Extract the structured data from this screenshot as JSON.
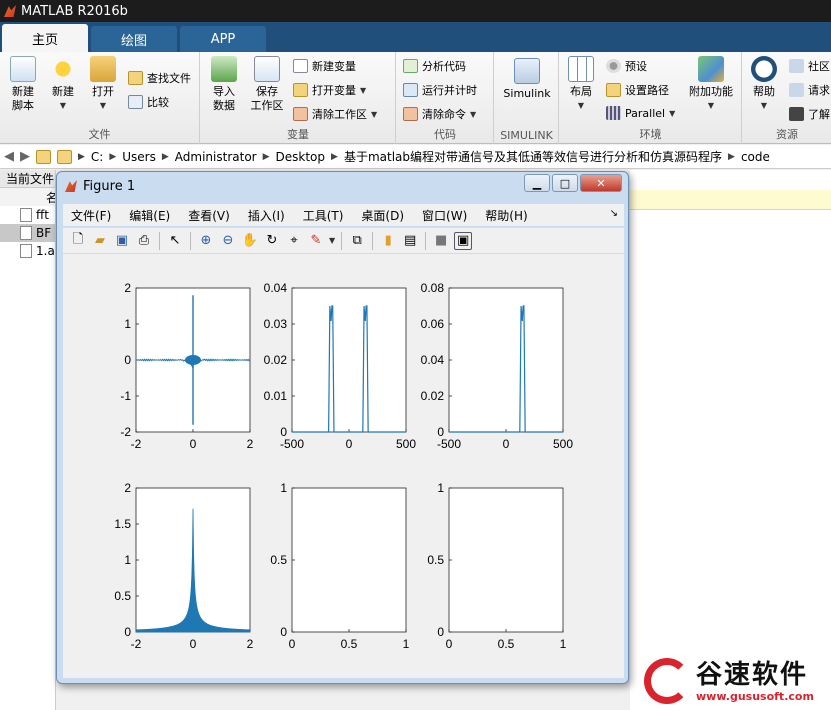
{
  "app": {
    "title": "MATLAB R2016b",
    "accent": "#1f4f7a"
  },
  "tabs": [
    {
      "label": "主页",
      "active": true
    },
    {
      "label": "绘图",
      "active": false
    },
    {
      "label": "APP",
      "active": false
    }
  ],
  "ribbon": {
    "file": {
      "label": "文件",
      "new_script": "新建\n脚本",
      "new": "新建",
      "open": "打开",
      "find_files": "查找文件",
      "compare": "比较"
    },
    "variable": {
      "label": "变量",
      "import": "导入\n数据",
      "save_ws": "保存\n工作区",
      "new_var": "新建变量",
      "open_var": "打开变量",
      "clear_ws": "清除工作区"
    },
    "code": {
      "label": "代码",
      "analyze": "分析代码",
      "run_time": "运行并计时",
      "clear_cmd": "清除命令"
    },
    "simulink": {
      "label": "SIMULINK",
      "button": "Simulink"
    },
    "env": {
      "label": "环境",
      "layout": "布局",
      "prefs": "预设",
      "set_path": "设置路径",
      "parallel": "Parallel",
      "addons": "附加功能"
    },
    "resources": {
      "label": "资源",
      "help": "帮助",
      "community": "社区",
      "request": "请求",
      "learn": "了解"
    }
  },
  "address": {
    "crumbs": [
      "C:",
      "Users",
      "Administrator",
      "Desktop",
      "基于matlab编程对带通信号及其低通等效信号进行分析和仿真源码程序",
      "code"
    ]
  },
  "left_panel": {
    "header": "当前文件",
    "col": "名",
    "files": [
      {
        "name": "fft",
        "selected": false
      },
      {
        "name": "BF",
        "selected": true
      },
      {
        "name": "1.a",
        "selected": false
      }
    ]
  },
  "figure": {
    "title": "Figure 1",
    "menus": [
      "文件(F)",
      "编辑(E)",
      "查看(V)",
      "插入(I)",
      "工具(T)",
      "桌面(D)",
      "窗口(W)",
      "帮助(H)"
    ]
  },
  "chart_data": [
    {
      "type": "line",
      "xlim": [
        -2,
        2
      ],
      "ylim": [
        -2,
        2
      ],
      "xticks": [
        "-2",
        "0",
        "2"
      ],
      "yticks": [
        "2",
        "1",
        "0",
        "-1",
        "-2"
      ],
      "series": [
        {
          "kind": "cross",
          "peak": 1.8
        }
      ]
    },
    {
      "type": "line",
      "xlim": [
        -500,
        500
      ],
      "ylim": [
        0,
        0.04
      ],
      "xticks": [
        "-500",
        "0",
        "500"
      ],
      "yticks": [
        "0.04",
        "0.03",
        "0.02",
        "0.01",
        "0"
      ],
      "series": [
        {
          "peaks": [
            {
              "x": -150,
              "y": 0.035
            },
            {
              "x": 150,
              "y": 0.035
            }
          ]
        }
      ]
    },
    {
      "type": "line",
      "xlim": [
        -500,
        500
      ],
      "ylim": [
        0,
        0.08
      ],
      "xticks": [
        "-500",
        "0",
        "500"
      ],
      "yticks": [
        "0.08",
        "0.06",
        "0.04",
        "0.02",
        "0"
      ],
      "series": [
        {
          "peaks": [
            {
              "x": 150,
              "y": 0.07
            }
          ]
        }
      ]
    },
    {
      "type": "line",
      "xlim": [
        -2,
        2
      ],
      "ylim": [
        0,
        2
      ],
      "xticks": [
        "-2",
        "0",
        "2"
      ],
      "yticks": [
        "2",
        "1.5",
        "1",
        "0.5",
        "0"
      ],
      "series": [
        {
          "kind": "spike",
          "peak": 1.85
        }
      ]
    },
    {
      "type": "line",
      "xlim": [
        0,
        1
      ],
      "ylim": [
        0,
        1
      ],
      "xticks": [
        "0",
        "0.5",
        "1"
      ],
      "yticks": [
        "1",
        "0.5",
        "0"
      ],
      "series": []
    },
    {
      "type": "line",
      "xlim": [
        0,
        1
      ],
      "ylim": [
        0,
        1
      ],
      "xticks": [
        "0",
        "0.5",
        "1"
      ],
      "yticks": [
        "1",
        "0.5",
        "0"
      ],
      "series": []
    }
  ],
  "watermark": {
    "name": "谷速软件",
    "url": "www.gususoft.com"
  }
}
